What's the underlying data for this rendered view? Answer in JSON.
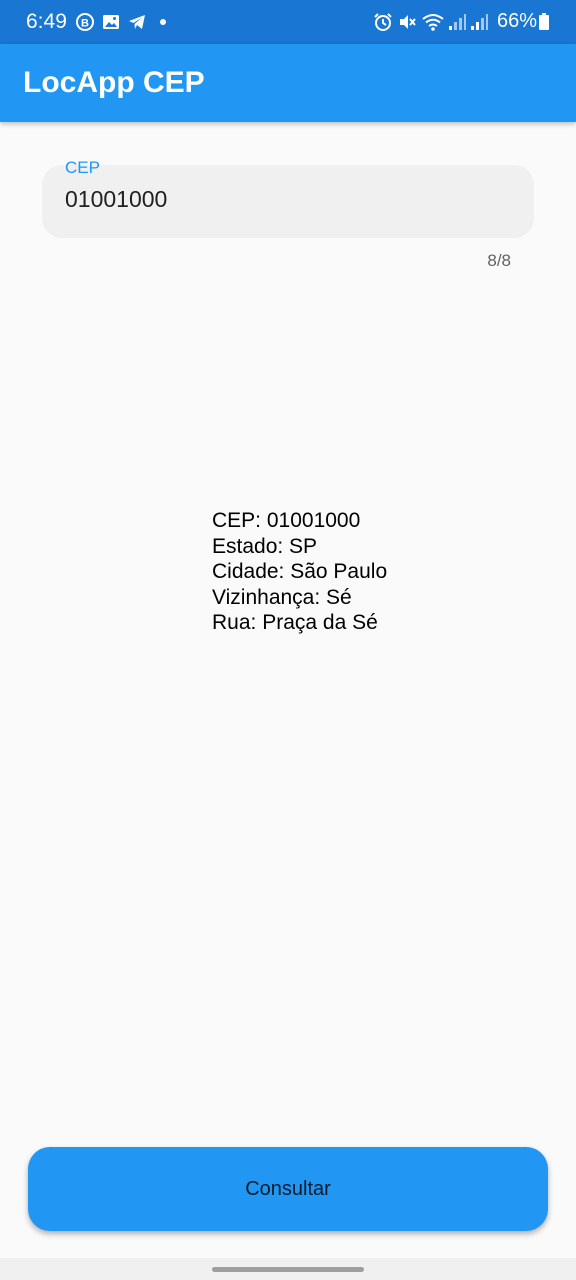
{
  "status_bar": {
    "time": "6:49",
    "battery": "66%",
    "icons": [
      "b-badge-icon",
      "gallery-icon",
      "telegram-icon",
      "alarm-icon",
      "mute-icon",
      "wifi-icon",
      "signal-icon",
      "signal-icon",
      "battery-icon"
    ]
  },
  "app_bar": {
    "title": "LocApp CEP"
  },
  "cep_field": {
    "label": "CEP",
    "value": "01001000",
    "counter": "8/8"
  },
  "result": {
    "lines": [
      "CEP: 01001000",
      "Estado: SP",
      "Cidade: São Paulo",
      "Vizinhança: Sé",
      "Rua: Praça da Sé"
    ]
  },
  "actions": {
    "consult_label": "Consultar"
  },
  "colors": {
    "status_bar": "#1976d2",
    "primary": "#2196f3",
    "field_bg": "#f0f0f0",
    "background": "#fafafa"
  }
}
